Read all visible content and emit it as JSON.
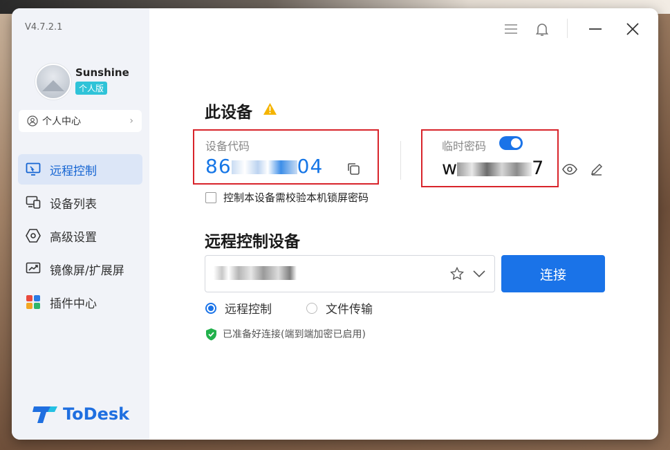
{
  "app": {
    "version": "V4.7.2.1",
    "brand": "ToDesk",
    "colors": {
      "accent": "#1a73e8",
      "highlight": "#d8232a",
      "sidebar_bg": "#f1f3f8",
      "badge": "#2fc3d8"
    }
  },
  "user": {
    "name": "Sunshine",
    "plan_badge": "个人版",
    "center_label": "个人中心"
  },
  "sidebar": {
    "items": [
      {
        "label": "远程控制",
        "icon": "remote-monitor-icon",
        "active": true
      },
      {
        "label": "设备列表",
        "icon": "device-list-icon",
        "active": false
      },
      {
        "label": "高级设置",
        "icon": "hexagon-settings-icon",
        "active": false
      },
      {
        "label": "镜像屏/扩展屏",
        "icon": "mirror-screen-icon",
        "active": false
      },
      {
        "label": "插件中心",
        "icon": "plugin-grid-icon",
        "active": false
      }
    ]
  },
  "this_device": {
    "title": "此设备",
    "code_label": "设备代码",
    "code_prefix": "86",
    "code_suffix": "04",
    "temp_password_label": "临时密码",
    "temp_password_prefix": "w",
    "temp_password_suffix": "7",
    "temp_password_enabled": true,
    "lock_screen_checkbox": "控制本设备需校验本机锁屏密码"
  },
  "remote": {
    "title": "远程控制设备",
    "connect_button": "连接",
    "modes": [
      {
        "label": "远程控制",
        "selected": true
      },
      {
        "label": "文件传输",
        "selected": false
      }
    ],
    "status": "已准备好连接(端到端加密已启用)"
  }
}
